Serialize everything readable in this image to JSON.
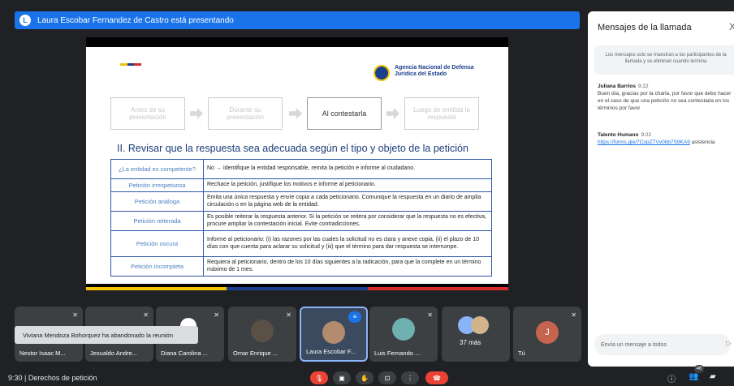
{
  "presenting": {
    "avatar_letter": "L",
    "text": "Laura Escobar Fernandez de Castro está presentando"
  },
  "slide": {
    "agency": "Agencia Nacional de Defensa Jurídica del Estado",
    "steps": [
      "Antes de su presentación",
      "Durante su presentación",
      "Al contestarla",
      "Luego de emitida la respuesta"
    ],
    "heading": "II. Revisar que la respuesta sea adecuada según el tipo y objeto de la petición",
    "rows": [
      {
        "key": "¿La entidad es competente?",
        "value": "No → Identifique la entidad responsable, remita la petición e informe al ciudadano."
      },
      {
        "key": "Petición irrespetuosa",
        "value": "Rechace la petición, justifique los motivos e informe al peticionario."
      },
      {
        "key": "Petición análoga",
        "value": "Emita una única respuesta y envíe copia a cada peticionario. Comunique la respuesta en un diario de amplia circulación o en la página web de la entidad."
      },
      {
        "key": "Petición reiterada",
        "value": "Es posible reiterar la respuesta anterior. Si la petición se reitera por considerar que la respuesta no es efectiva, procure ampliar la contestación inicial. Evite contradicciones."
      },
      {
        "key": "Petición oscura",
        "value": "Informe al peticionario: (i) las razones por las cuales la solicitud no es clara y anexe copia, (ii) el plazo de 10 días con que cuenta para aclarar su solicitud y (iii) que el término para dar respuesta se interrumpe."
      },
      {
        "key": "Petición incompleta",
        "value": "Requiera al peticionario, dentro de los 10 días siguientes a la radicación, para que la complete en un término máximo de 1 mes."
      }
    ]
  },
  "chat": {
    "title": "Mensajes de la llamada",
    "close_glyph": "X",
    "notice": "Los mensajes solo se muestran a los participantes de la llamada y se eliminan cuando termina",
    "messages": [
      {
        "sender": "Juliana Barrios",
        "time": "9:22",
        "text": "Buen día, gracias por la charla, por favor que debo hacer en el caso de que una petición no sea contestada en los términos por favor"
      },
      {
        "sender": "Talento Humano",
        "time": "9:22",
        "link": "https://forms.gle/7CopZTVv0bb7S9KA9",
        "text": "asistencia"
      }
    ],
    "input_placeholder": "Envía un mensaje a todos"
  },
  "participants": [
    {
      "name": "Nestor Isaac M..."
    },
    {
      "name": "Jesualdo Andre..."
    },
    {
      "name": "Diana Carolina ..."
    },
    {
      "name": "Omar Enrique ..."
    },
    {
      "name": "Laura Escobar F..."
    },
    {
      "name": "Luis Fernando ..."
    },
    {
      "name": "37 más",
      "count": "37 más"
    },
    {
      "name": "Tú",
      "avatar_letter": "J"
    }
  ],
  "toast": "Viviana Mendoza Bohorquez ha abandonado la reunión",
  "bottom": {
    "time_title": "9:30  |  Derechos de petición",
    "people_badge": "46"
  },
  "colors": {
    "accent": "#1a73e8",
    "end_call": "#ea4335",
    "table_border": "#2e57a8"
  }
}
